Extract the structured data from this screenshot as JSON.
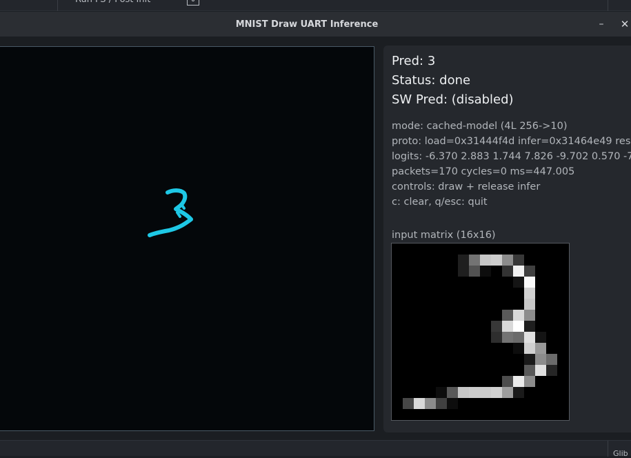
{
  "taskbar": {
    "item_label": "Run FS / Post Init",
    "item_icon": "download-icon"
  },
  "window": {
    "title": "MNIST Draw UART Inference",
    "minimize_label": "–",
    "close_label": "✕"
  },
  "canvas": {
    "stroke_color": "#1ec8e6",
    "background": "#04070a"
  },
  "info": {
    "pred": "Pred: 3",
    "status": "Status: done",
    "sw_pred": "SW Pred: (disabled)",
    "mode": "mode: cached-model (4L 256->10)",
    "proto": "proto: load=0x31444f4d infer=0x31464e49 res",
    "logits": "logits: -6.370 2.883 1.744 7.826 -9.702 0.570 -7",
    "packets": "packets=170 cycles=0 ms=447.005",
    "controls": "controls: draw + release infer",
    "keys": "c: clear, q/esc: quit",
    "matrix_label": "input matrix (16x16)"
  },
  "matrix": {
    "size": 16,
    "cells": [
      [
        0,
        0,
        0,
        0,
        0,
        0,
        0,
        0,
        0,
        0,
        0,
        0,
        0,
        0,
        0,
        0
      ],
      [
        0,
        0,
        0,
        0,
        0,
        0,
        0.12,
        0.45,
        0.78,
        0.8,
        0.55,
        0.22,
        0,
        0,
        0,
        0
      ],
      [
        0,
        0,
        0,
        0,
        0,
        0,
        0.12,
        0.32,
        0.05,
        0,
        0.2,
        0.95,
        0.25,
        0,
        0,
        0
      ],
      [
        0,
        0,
        0,
        0,
        0,
        0,
        0,
        0,
        0,
        0,
        0,
        0.08,
        0.98,
        0,
        0,
        0
      ],
      [
        0,
        0,
        0,
        0,
        0,
        0,
        0,
        0,
        0,
        0,
        0,
        0,
        0.82,
        0,
        0,
        0
      ],
      [
        0,
        0,
        0,
        0,
        0,
        0,
        0,
        0,
        0,
        0,
        0,
        0,
        0.78,
        0,
        0,
        0
      ],
      [
        0,
        0,
        0,
        0,
        0,
        0,
        0,
        0,
        0,
        0,
        0.35,
        0.85,
        0.55,
        0,
        0,
        0
      ],
      [
        0,
        0,
        0,
        0,
        0,
        0,
        0,
        0,
        0,
        0.22,
        0.85,
        1.0,
        0.12,
        0,
        0,
        0
      ],
      [
        0,
        0,
        0,
        0,
        0,
        0,
        0,
        0,
        0,
        0.18,
        0.45,
        0.42,
        0.88,
        0.08,
        0,
        0
      ],
      [
        0,
        0,
        0,
        0,
        0,
        0,
        0,
        0,
        0,
        0,
        0,
        0.05,
        0.82,
        0.6,
        0,
        0
      ],
      [
        0,
        0,
        0,
        0,
        0,
        0,
        0,
        0,
        0,
        0,
        0,
        0,
        0.1,
        0.55,
        0.42,
        0
      ],
      [
        0,
        0,
        0,
        0,
        0,
        0,
        0,
        0,
        0,
        0,
        0,
        0,
        0.35,
        0.88,
        0.15,
        0
      ],
      [
        0,
        0,
        0,
        0,
        0,
        0,
        0,
        0,
        0,
        0,
        0.3,
        0.92,
        0.55,
        0,
        0,
        0
      ],
      [
        0,
        0,
        0,
        0,
        0.05,
        0.35,
        0.78,
        0.8,
        0.8,
        0.82,
        0.62,
        0.1,
        0,
        0,
        0,
        0
      ],
      [
        0,
        0.28,
        0.85,
        0.55,
        0.25,
        0.05,
        0,
        0,
        0,
        0,
        0,
        0,
        0,
        0,
        0,
        0
      ],
      [
        0,
        0,
        0,
        0,
        0,
        0,
        0,
        0,
        0,
        0,
        0,
        0,
        0,
        0,
        0,
        0
      ]
    ]
  },
  "statusbar": {
    "corner_label": "Glib"
  }
}
